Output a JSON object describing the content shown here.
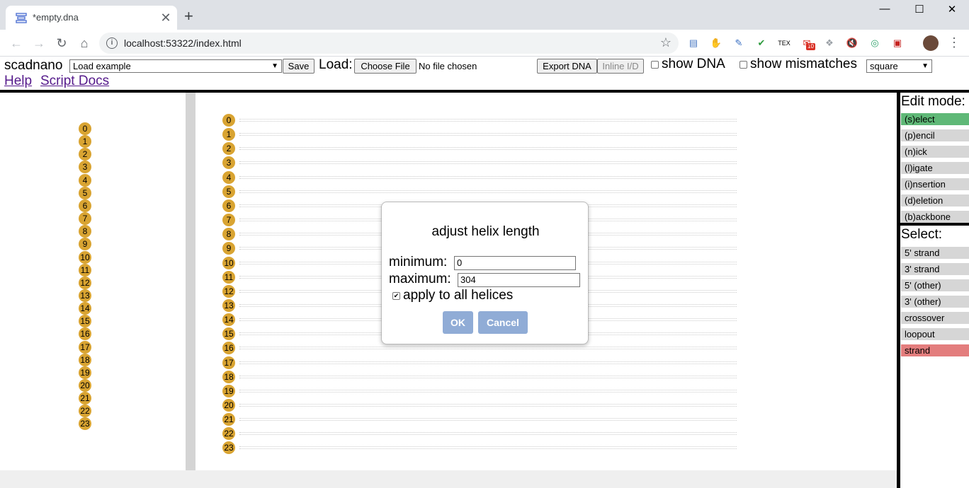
{
  "browser": {
    "tab_title": "*empty.dna",
    "close_glyph": "✕",
    "new_tab_glyph": "+",
    "window_controls": [
      "—",
      "☐",
      "✕"
    ],
    "nav": {
      "back": "←",
      "forward": "→",
      "reload": "↻",
      "home": "⌂"
    },
    "url": "localhost:53322/index.html",
    "info_glyph": "i",
    "star_glyph": "☆",
    "menu_glyph": "⋮",
    "extensions": [
      {
        "name": "chat-extension-icon",
        "glyph": "▤",
        "color": "#4a78c2"
      },
      {
        "name": "adblock-icon",
        "glyph": "✋",
        "color": "#d42a1e"
      },
      {
        "name": "pen-extension-icon",
        "glyph": "✎",
        "color": "#3a6fc2"
      },
      {
        "name": "checkmark-extension-icon",
        "glyph": "✔",
        "color": "#2e9b3e"
      },
      {
        "name": "tex-extension-icon",
        "glyph": "TEX",
        "color": "#000000"
      },
      {
        "name": "gmail-extension-icon",
        "glyph": "✉",
        "color": "#d93025",
        "badge": "10"
      },
      {
        "name": "dropbox-icon",
        "glyph": "❖",
        "color": "#9aa0a6"
      },
      {
        "name": "mute-icon",
        "glyph": "🔇",
        "color": "#202124"
      },
      {
        "name": "color-picker-icon",
        "glyph": "◎",
        "color": "#2fa36b"
      },
      {
        "name": "red-square-extension-icon",
        "glyph": "▣",
        "color": "#c5221f"
      }
    ]
  },
  "app": {
    "title": "scadnano",
    "load_example": "Load example",
    "save": "Save",
    "load_label": "Load:",
    "choose_file": "Choose File",
    "no_file": "No file chosen",
    "export_dna": "Export DNA",
    "inline_id": "Inline I/D",
    "show_dna": "show DNA",
    "show_mismatches": "show mismatches",
    "grid": "square",
    "help": "Help",
    "script_docs": "Script Docs",
    "dropdown_arrow": "▼"
  },
  "helices": [
    "0",
    "1",
    "2",
    "3",
    "4",
    "5",
    "6",
    "7",
    "8",
    "9",
    "10",
    "11",
    "12",
    "13",
    "14",
    "15",
    "16",
    "17",
    "18",
    "19",
    "20",
    "21",
    "22",
    "23"
  ],
  "helix_color": "#d9a432",
  "edit_mode": {
    "heading": "Edit mode:",
    "modes": [
      "(s)elect",
      "(p)encil",
      "(n)ick",
      "(l)igate",
      "(i)nsertion",
      "(d)eletion",
      "(b)ackbone"
    ],
    "active_color": "#5fb877"
  },
  "select": {
    "heading": "Select:",
    "items": [
      "5' strand",
      "3' strand",
      "5' (other)",
      "3' (other)",
      "crossover",
      "loopout",
      "strand"
    ],
    "active_color": "#e37d7d"
  },
  "dialog": {
    "title": "adjust helix length",
    "minimum_label": "minimum:",
    "minimum_value": "0",
    "maximum_label": "maximum:",
    "maximum_value": "304",
    "apply_all_label": "apply to all helices",
    "apply_all_checked": true,
    "check_glyph": "✔",
    "ok": "OK",
    "cancel": "Cancel"
  }
}
